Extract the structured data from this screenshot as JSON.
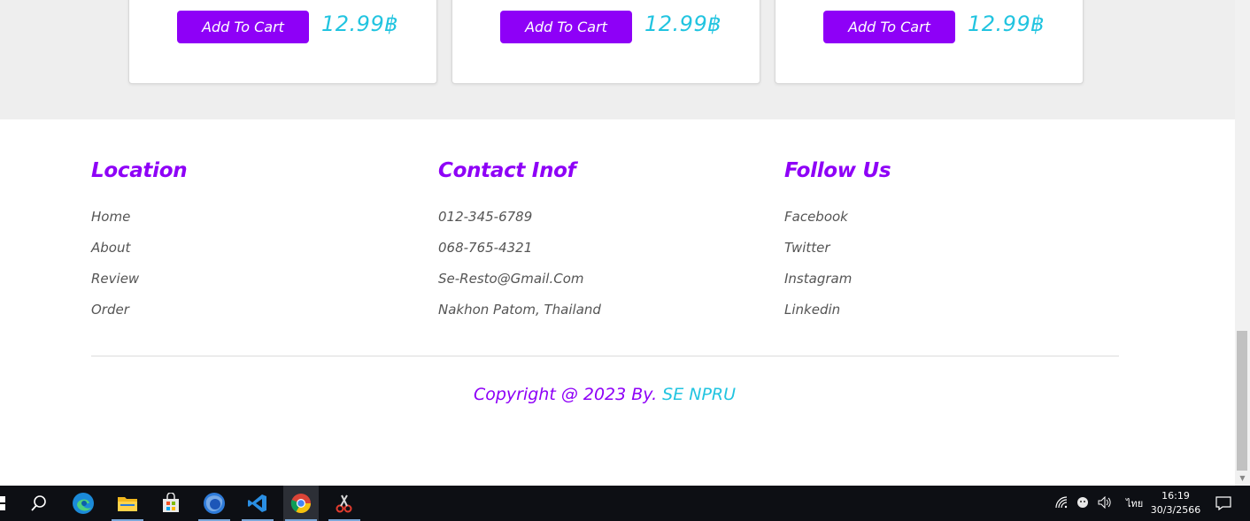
{
  "products": {
    "cards": [
      {
        "button_label": "Add To Cart",
        "price": "12.99฿"
      },
      {
        "button_label": "Add To Cart",
        "price": "12.99฿"
      },
      {
        "button_label": "Add To Cart",
        "price": "12.99฿"
      }
    ]
  },
  "footer": {
    "columns": [
      {
        "heading": "Location",
        "links": [
          "Home",
          "About",
          "Review",
          "Order"
        ]
      },
      {
        "heading": "Contact Inof",
        "links": [
          "012-345-6789",
          "068-765-4321",
          "Se-Resto@Gmail.Com",
          "Nakhon Patom, Thailand"
        ]
      },
      {
        "heading": "Follow Us",
        "links": [
          "Facebook",
          "Twitter",
          "Instagram",
          "Linkedin"
        ]
      }
    ],
    "copyright_prefix": "Copyright @ 2023 By.",
    "copyright_brand": "SE NPRU"
  },
  "taskbar": {
    "apps": [
      "start-icon",
      "search-icon",
      "edge-icon",
      "file-explorer-icon",
      "store-icon",
      "firefox-icon",
      "vscode-icon",
      "chrome-icon",
      "snipping-tool-icon"
    ],
    "tray_language": "ไทย",
    "time": "16:19",
    "date": "30/3/2566"
  },
  "colors": {
    "accent_purple": "#8e00f7",
    "accent_cyan": "#22c4e0",
    "band_gray": "#eeeeee"
  }
}
